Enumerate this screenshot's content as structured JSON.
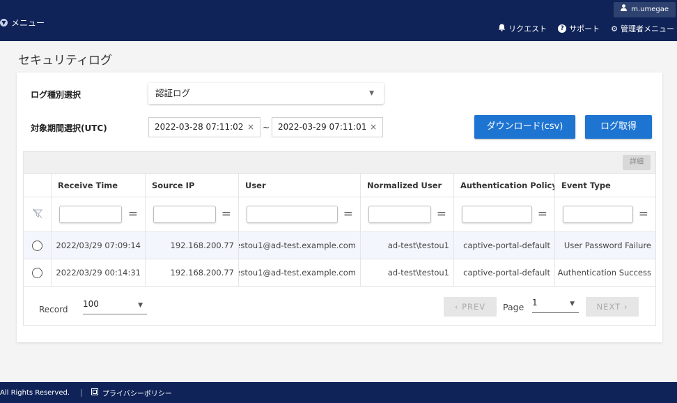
{
  "header": {
    "menu_label": "メニュー",
    "user_name": "m.umegae",
    "nav": {
      "request": "リクエスト",
      "support": "サポート",
      "admin_menu": "管理者メニュー"
    }
  },
  "page": {
    "title": "セキュリティログ"
  },
  "filters": {
    "log_type_label": "ログ種別選択",
    "log_type_value": "認証ログ",
    "period_label": "対象期間選択(UTC)",
    "date_from": "2022-03-28 07:11:02",
    "date_to": "2022-03-29 07:11:01",
    "range_sep": "~",
    "download_button": "ダウンロード(csv)",
    "fetch_button": "ログ取得"
  },
  "table": {
    "detail_button": "詳細",
    "columns": [
      "Receive Time",
      "Source IP",
      "User",
      "Normalized User",
      "Authentication Policy",
      "Event Type"
    ],
    "rows": [
      [
        "2022/03/29 07:09:14",
        "192.168.200.77",
        "testou1@ad-test.example.com",
        "ad-test\\testou1",
        "captive-portal-default",
        "User Password Failure"
      ],
      [
        "2022/03/29 00:14:31",
        "192.168.200.77",
        "testou1@ad-test.example.com",
        "ad-test\\testou1",
        "captive-portal-default",
        "Authentication Success"
      ]
    ],
    "filter_equals": "="
  },
  "pager": {
    "record_label": "Record",
    "record_value": "100",
    "prev_label": "PREV",
    "page_label": "Page",
    "page_value": "1",
    "next_label": "NEXT"
  },
  "footer": {
    "copyright": "All Rights Reserved.",
    "privacy_link": "プライバシーポリシー"
  },
  "colors": {
    "navy": "#0f2358",
    "accent_blue": "#1e74d1"
  }
}
